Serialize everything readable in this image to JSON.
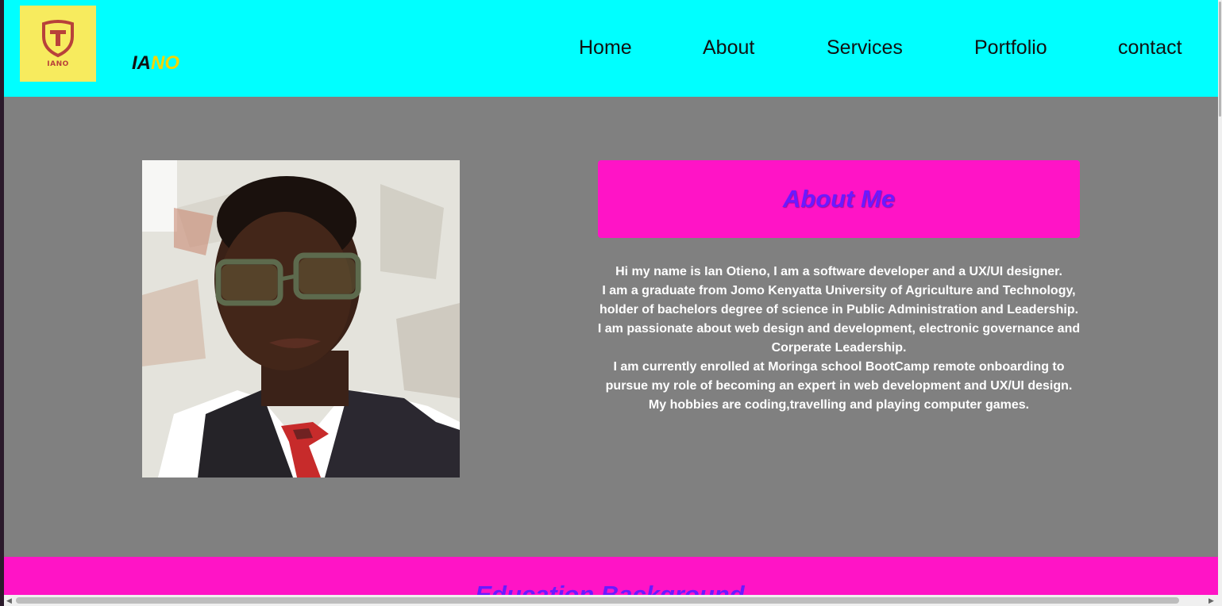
{
  "header": {
    "logo_text": "IANO",
    "brand_part1": "IA",
    "brand_part2": "NO",
    "nav": [
      "Home",
      "About",
      "Services",
      "Portfolio",
      "contact"
    ]
  },
  "about": {
    "title": "About Me",
    "paragraphs": [
      "Hi my name is Ian Otieno, I am a software developer and a UX/UI designer.",
      "I am a graduate from Jomo Kenyatta University of Agriculture and Technology, holder of bachelors degree of science in Public Administration and Leadership.",
      "I am passionate about web design and development, electronic governance and Corperate Leadership.",
      "I am currently enrolled at Moringa school BootCamp remote onboarding to pursue my role of becoming an expert in web development and UX/UI design.",
      "My hobbies are coding,travelling and playing computer games."
    ]
  },
  "education": {
    "title": "Education Background"
  },
  "colors": {
    "header_bg": "#00ffff",
    "page_bg": "#808080",
    "accent_pink": "#ff14c6",
    "title_purple": "#6b1aff",
    "brand_yellow": "#f5d500",
    "logo_bg": "#f7eb5e"
  },
  "icons": {
    "logo": "shield-emblem-icon",
    "scroll_left": "arrow-left-icon",
    "scroll_right": "arrow-right-icon"
  }
}
